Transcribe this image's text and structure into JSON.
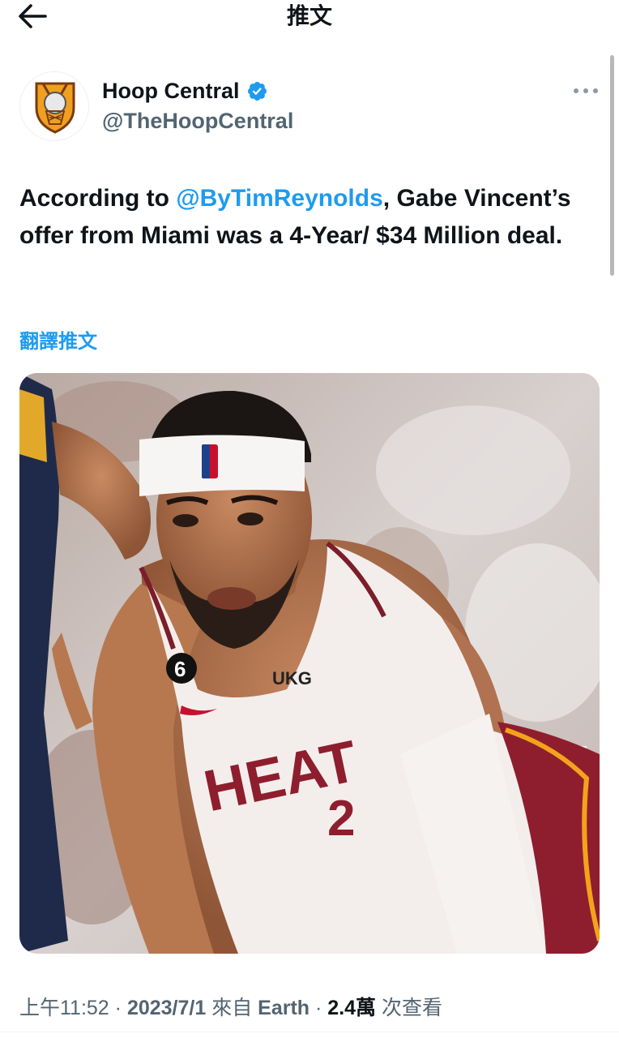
{
  "header": {
    "title": "推文",
    "back_icon": "arrow-left-icon"
  },
  "author": {
    "display_name": "Hoop Central",
    "handle": "@TheHoopCentral",
    "verified": true,
    "verified_color": "#1d9bf0",
    "avatar_icon": "hoop-central-logo"
  },
  "tweet": {
    "text_before": "According to ",
    "mention": "@ByTimReynolds",
    "text_after": ", Gabe Vincent’s offer from Miami was a 4-Year/ $34 Million deal.",
    "translate_label": "翻譯推文",
    "media_description_icon": "photo"
  },
  "meta": {
    "time": "上午11:52",
    "sep1": " · ",
    "date": "2023/7/1",
    "source_prefix": " 來自 ",
    "source": "Earth",
    "sep2": " · ",
    "views_count": "2.4萬",
    "views_label": " 次查看"
  },
  "colors": {
    "accent": "#1d9bf0",
    "text": "#0f1419",
    "secondary": "#536471"
  }
}
